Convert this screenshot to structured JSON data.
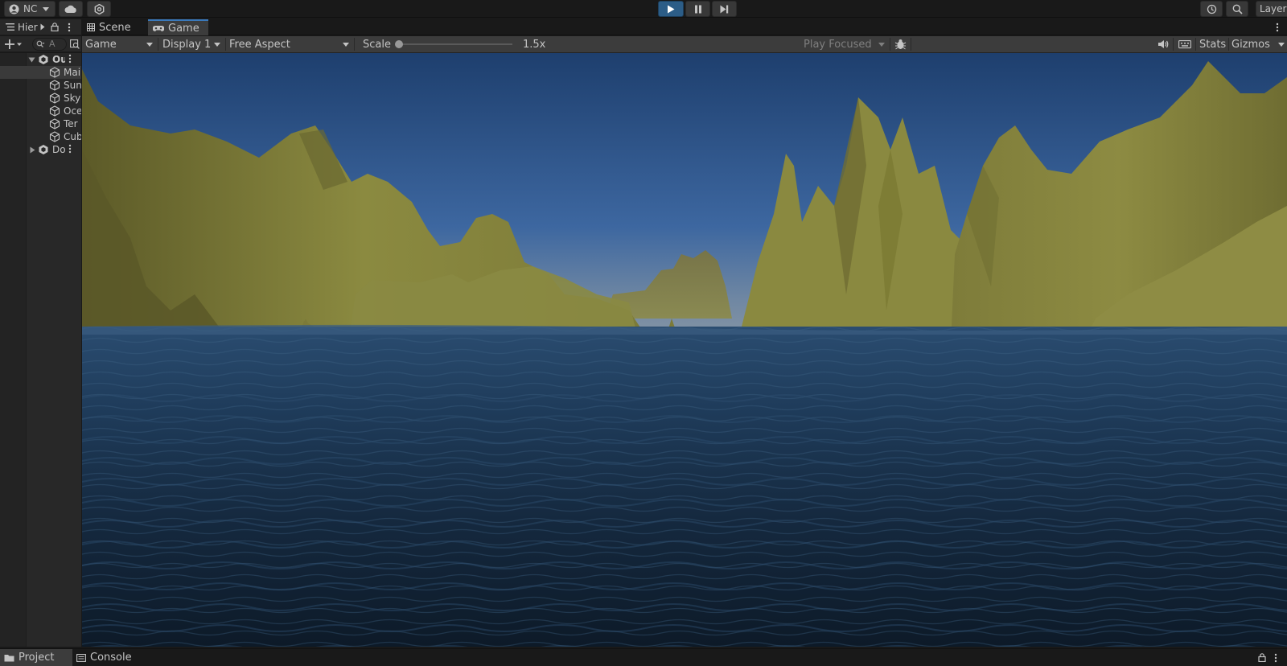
{
  "toolbar": {
    "account_label": "NC",
    "layers_label": "Layers",
    "play_state": "playing",
    "accent_color": "#2c5d87"
  },
  "hierarchy": {
    "tab_label": "Hier",
    "search_placeholder": "A",
    "items": [
      {
        "label": "Ou",
        "kind": "scene",
        "expanded": true
      },
      {
        "label": "Mai",
        "kind": "gameobject",
        "selected": true
      },
      {
        "label": "Sun",
        "kind": "gameobject"
      },
      {
        "label": "Sky",
        "kind": "gameobject"
      },
      {
        "label": "Oce",
        "kind": "gameobject"
      },
      {
        "label": "Ter",
        "kind": "gameobject"
      },
      {
        "label": "Cub",
        "kind": "gameobject"
      },
      {
        "label": "Do",
        "kind": "scene",
        "expanded": false
      }
    ]
  },
  "tabs": {
    "scene": "Scene",
    "game": "Game"
  },
  "game_toolbar": {
    "view_mode": "Game",
    "display": "Display 1",
    "aspect": "Free Aspect",
    "scale_label": "Scale",
    "scale_value": "1.5x",
    "play_mode": "Play Focused",
    "stats_label": "Stats",
    "gizmos_label": "Gizmos"
  },
  "bottom_tabs": {
    "project": "Project",
    "console": "Console"
  },
  "colors": {
    "sky_top": "#1e3f6e",
    "sky_horizon": "#6f87a3",
    "terrain": "#8a8a3e",
    "ocean": "#1e3b58"
  }
}
